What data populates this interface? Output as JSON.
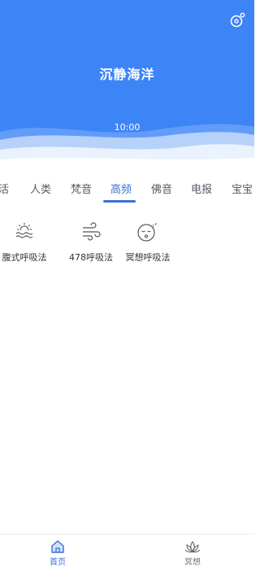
{
  "header": {
    "title": "沉静海洋",
    "timer": "10:00",
    "settings_icon": "cycle-settings-icon"
  },
  "tabs": [
    {
      "label": "活"
    },
    {
      "label": "人类"
    },
    {
      "label": "梵音"
    },
    {
      "label": "高频"
    },
    {
      "label": "佛音"
    },
    {
      "label": "电报"
    },
    {
      "label": "宝宝"
    }
  ],
  "active_tab": "高频",
  "items": [
    {
      "label": "腹式呼吸法",
      "icon": "sunrise-waves-icon"
    },
    {
      "label": "478呼吸法",
      "icon": "wind-icon"
    },
    {
      "label": "冥想呼吸法",
      "icon": "sleeping-face-icon"
    }
  ],
  "bottom_nav": [
    {
      "label": "首页",
      "icon": "home-icon",
      "active": true
    },
    {
      "label": "冥想",
      "icon": "lotus-icon",
      "active": false
    }
  ],
  "colors": {
    "hero": "#3d84f7",
    "accent": "#3d6fd8"
  }
}
